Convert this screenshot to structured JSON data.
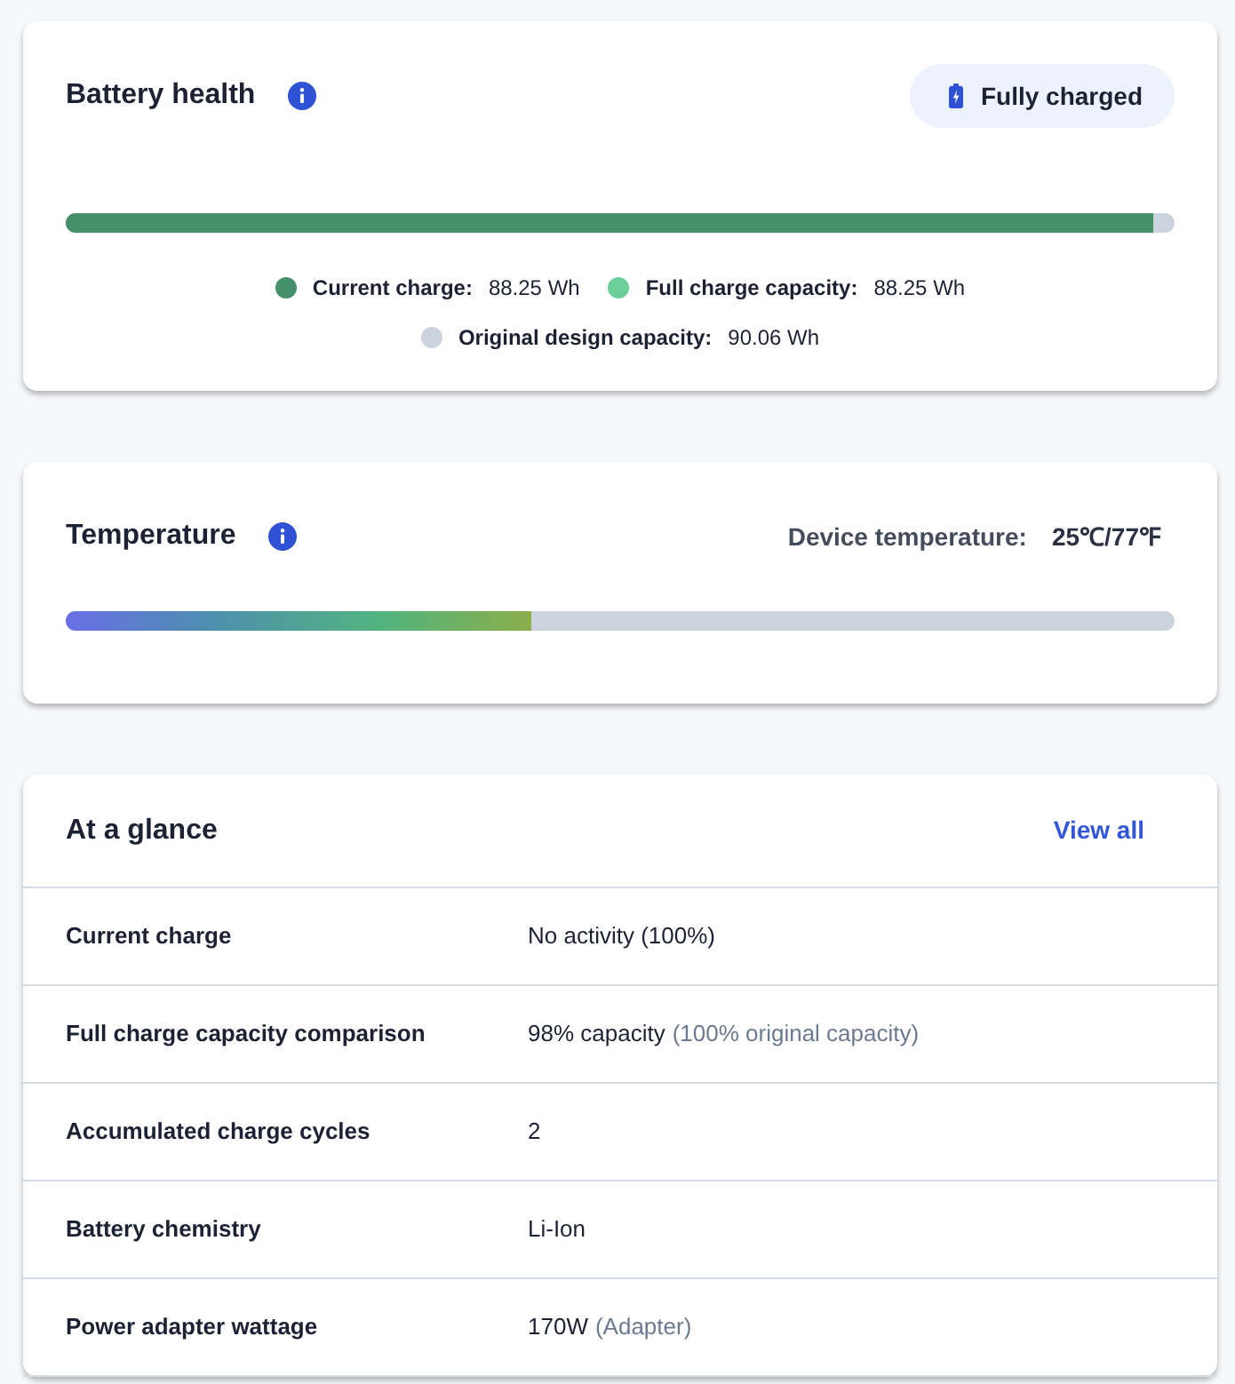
{
  "battery_health": {
    "title": "Battery health",
    "status": {
      "label": "Fully charged"
    },
    "bar": {
      "level": 0.98
    },
    "legend": [
      {
        "label": "Current charge:",
        "value": "88.25 Wh",
        "color": "#458f6a"
      },
      {
        "label": "Full charge capacity:",
        "value": "88.25 Wh",
        "color": "#6bcf9a"
      },
      {
        "label": "Original design capacity:",
        "value": "90.06 Wh",
        "color": "#cbd3df"
      }
    ]
  },
  "temperature": {
    "title": "Temperature",
    "reading_label": "Device temperature:",
    "reading": "25℃/77℉",
    "bar": {
      "level": 0.42
    }
  },
  "at_a_glance": {
    "title": "At a glance",
    "link": "View all",
    "rows": [
      {
        "label": "Current charge",
        "value": "No activity (100%)"
      },
      {
        "label": "Full charge capacity comparison",
        "value": "98% capacity",
        "note": "(100% original capacity)"
      },
      {
        "label": "Accumulated charge cycles",
        "value": "2"
      },
      {
        "label": "Battery chemistry",
        "value": "Li-Ion"
      },
      {
        "label": "Power adapter wattage",
        "value": "170W",
        "note": "(Adapter)"
      }
    ]
  }
}
